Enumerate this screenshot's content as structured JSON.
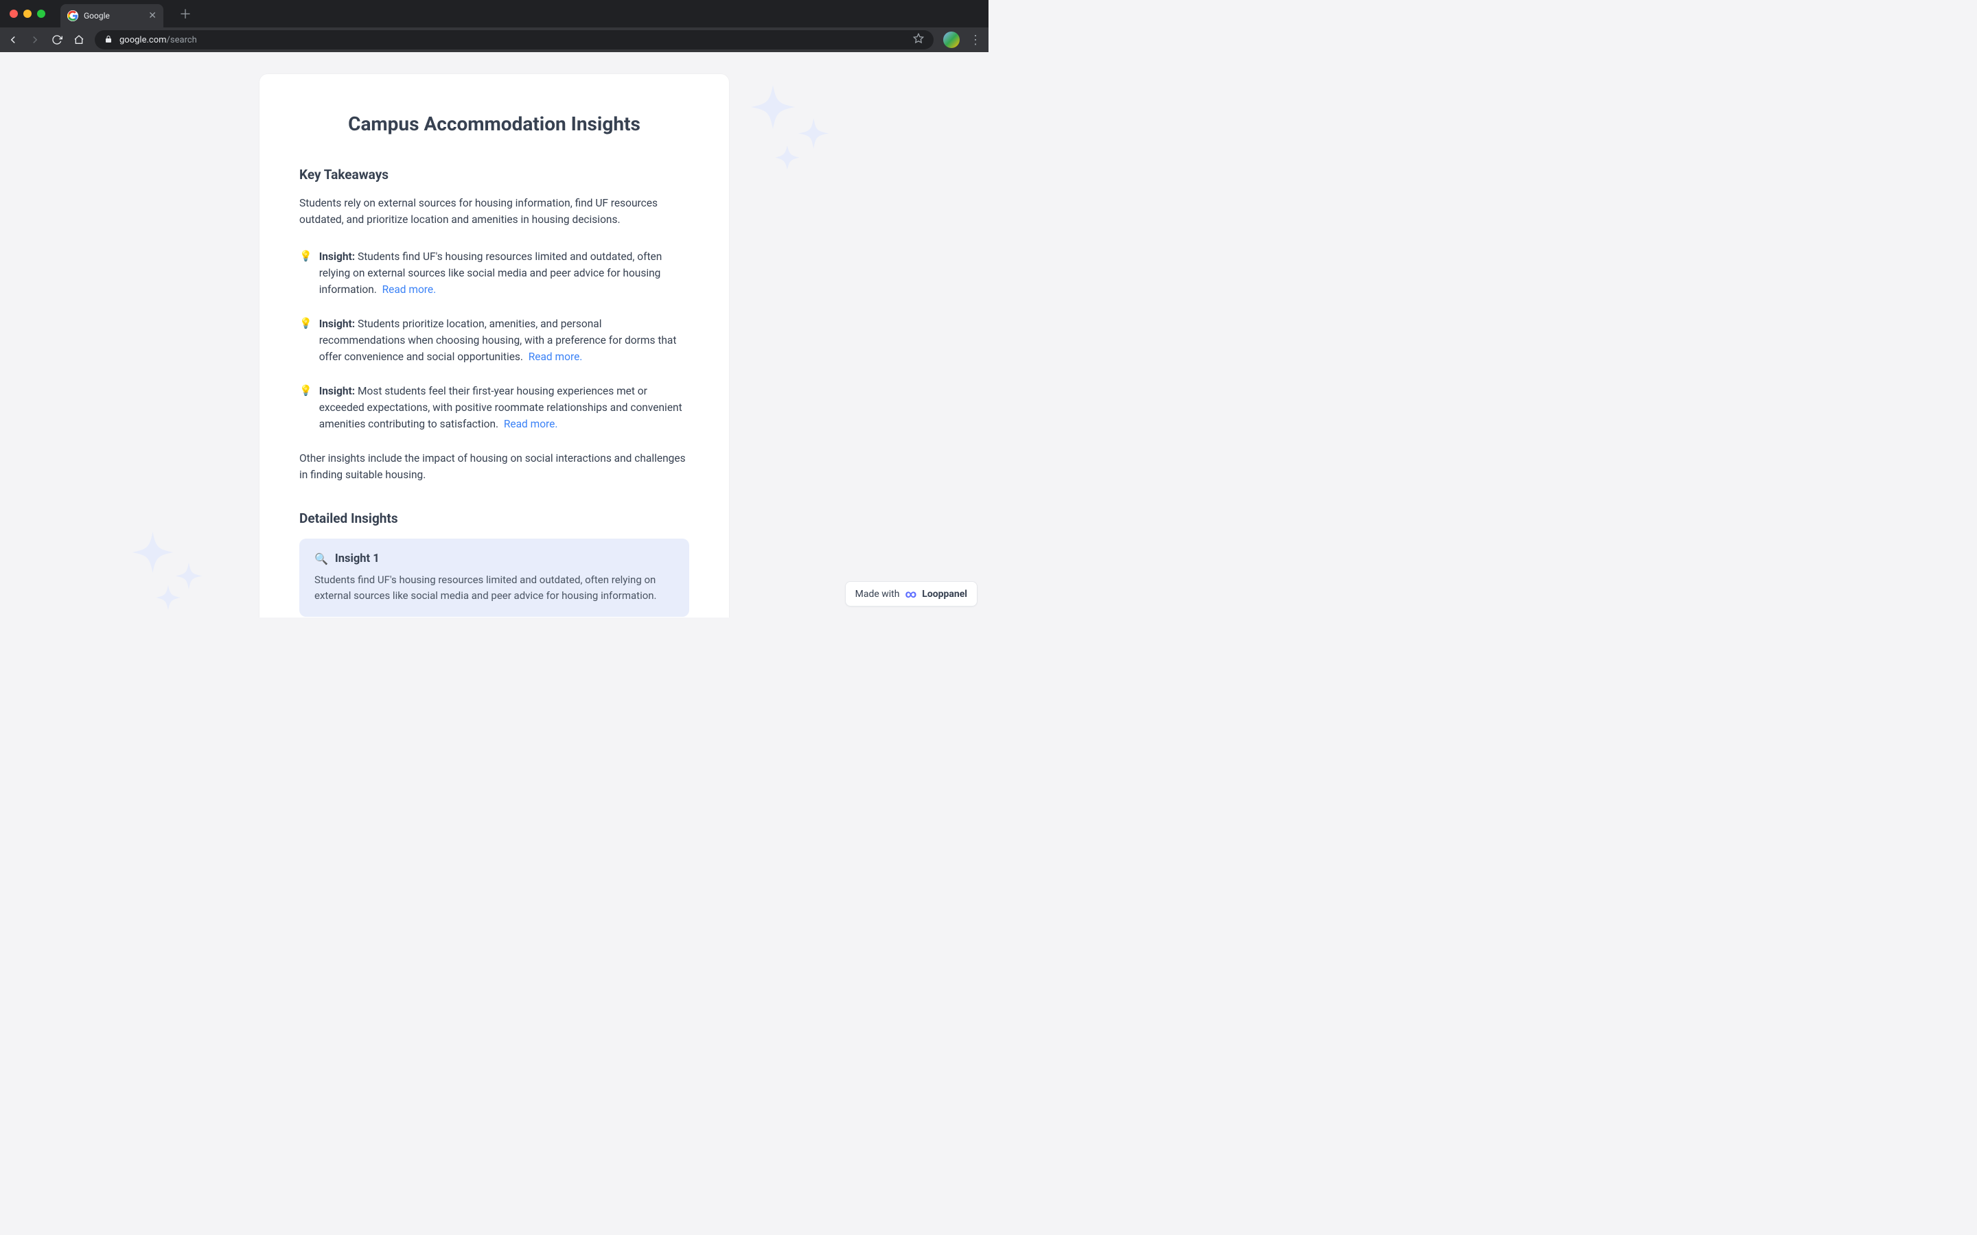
{
  "chrome": {
    "tab_title": "Google",
    "url_host": "google.com",
    "url_path": "/search"
  },
  "main": {
    "title": "Campus Accommodation Insights",
    "section_takeaways": "Key Takeaways",
    "summary": "Students rely on external sources for housing information, find UF resources outdated, and prioritize location and amenities in housing decisions.",
    "insight_label": "Insight:",
    "insights": [
      {
        "text": "Students find UF's housing resources limited and outdated, often relying on external sources like social media and peer advice for housing information.",
        "read_more": "Read more."
      },
      {
        "text": "Students prioritize location, amenities, and personal recommendations when choosing housing, with a preference for dorms that offer convenience and social opportunities.",
        "read_more": "Read more."
      },
      {
        "text": "Most students feel their first-year housing experiences met or exceeded expectations, with positive roommate relationships and convenient amenities contributing to satisfaction.",
        "read_more": "Read more."
      }
    ],
    "other_insights": "Other insights include the impact of housing on social interactions and challenges in finding suitable housing.",
    "section_detailed": "Detailed Insights",
    "detail1": {
      "title": "Insight 1",
      "body": "Students find UF's housing resources limited and outdated, often relying on external sources like social media and peer advice for housing information."
    }
  },
  "badge": {
    "prefix": "Made with",
    "brand": "Looppanel"
  }
}
